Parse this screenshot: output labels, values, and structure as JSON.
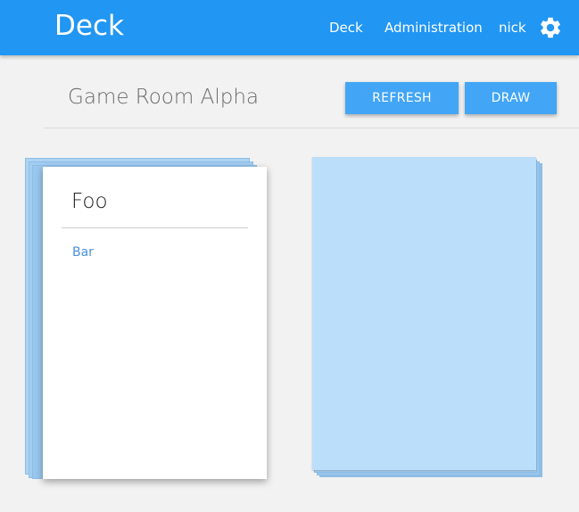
{
  "app": {
    "brand": "Deck",
    "colors": {
      "primary": "#2196f3",
      "button": "#42a5f5",
      "card_back": "#bbdefb",
      "link": "#4a90d9"
    }
  },
  "nav": {
    "deck": "Deck",
    "administration": "Administration",
    "user": "nick",
    "settings_icon": "gear-icon"
  },
  "room": {
    "title": "Game Room Alpha",
    "refresh_label": "REFRESH",
    "draw_label": "DRAW"
  },
  "hand": {
    "card": {
      "title": "Foo",
      "body": "Bar"
    }
  }
}
